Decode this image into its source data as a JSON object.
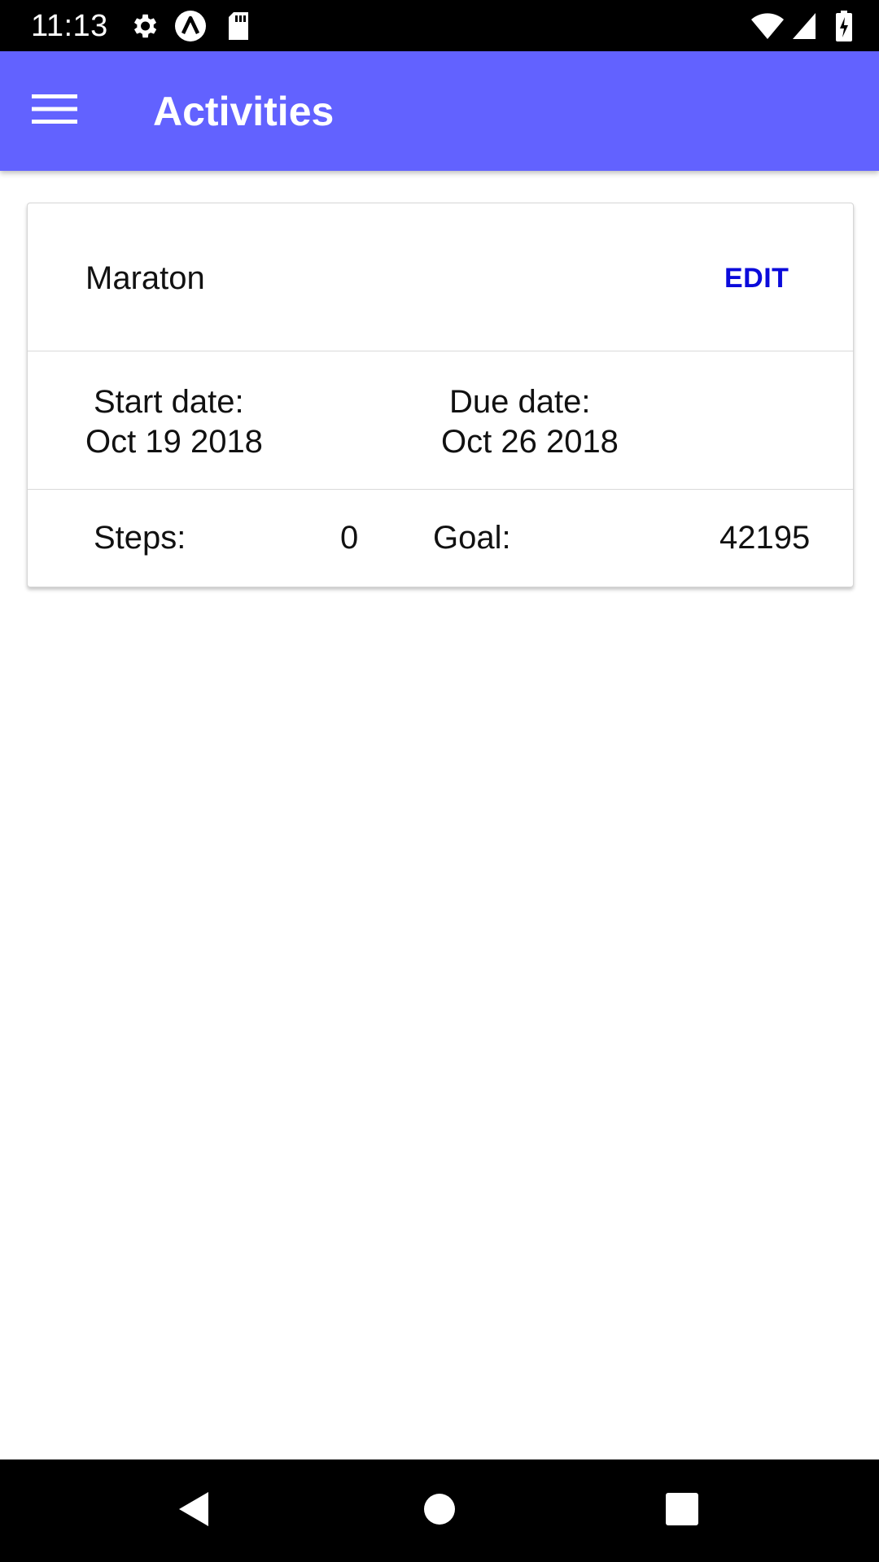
{
  "status_bar": {
    "time": "11:13",
    "left_icons": [
      "gear-icon",
      "a-badge-icon",
      "sd-card-icon"
    ],
    "right_icons": [
      "wifi-icon",
      "cell-signal-icon",
      "battery-charging-icon"
    ]
  },
  "app_bar": {
    "title": "Activities",
    "color": "#6262FF",
    "menu_icon": "hamburger-menu-icon"
  },
  "activity_card": {
    "name": "Maraton",
    "edit_label": "EDIT",
    "edit_color": "#0b0bdb",
    "start_label": "Start date:",
    "start_value": "Oct 19 2018",
    "due_label": "Due date:",
    "due_value": "Oct 26 2018",
    "steps_label": "Steps:",
    "steps_value": "0",
    "goal_label": "Goal:",
    "goal_value": "42195"
  },
  "nav_bar": {
    "buttons": [
      "back-icon",
      "home-icon",
      "recents-icon"
    ]
  }
}
